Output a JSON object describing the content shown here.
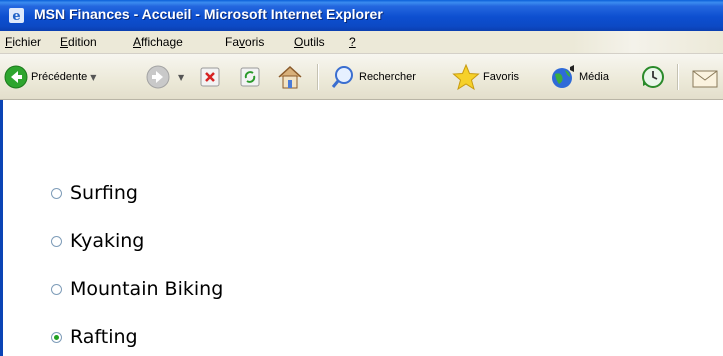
{
  "window": {
    "title": "MSN Finances - Accueil - Microsoft Internet Explorer"
  },
  "menubar": {
    "items": [
      {
        "label": "Fichier",
        "accel": "F"
      },
      {
        "label": "Edition",
        "accel": "E"
      },
      {
        "label": "Affichage",
        "accel": "A"
      },
      {
        "label": "Favoris",
        "accel": "v"
      },
      {
        "label": "Outils",
        "accel": "O"
      },
      {
        "label": "?",
        "accel": "?"
      }
    ]
  },
  "toolbar": {
    "back_label": "Précédente",
    "search_label": "Rechercher",
    "favorites_label": "Favoris",
    "media_label": "Média"
  },
  "options": [
    {
      "label": "Surfing",
      "checked": false
    },
    {
      "label": "Kyaking",
      "checked": false
    },
    {
      "label": "Mountain Biking",
      "checked": false
    },
    {
      "label": "Rafting",
      "checked": true
    }
  ],
  "colors": {
    "titlebar": "#0c49c4",
    "chrome": "#ece9d8",
    "radio_selected": "#21a121"
  }
}
